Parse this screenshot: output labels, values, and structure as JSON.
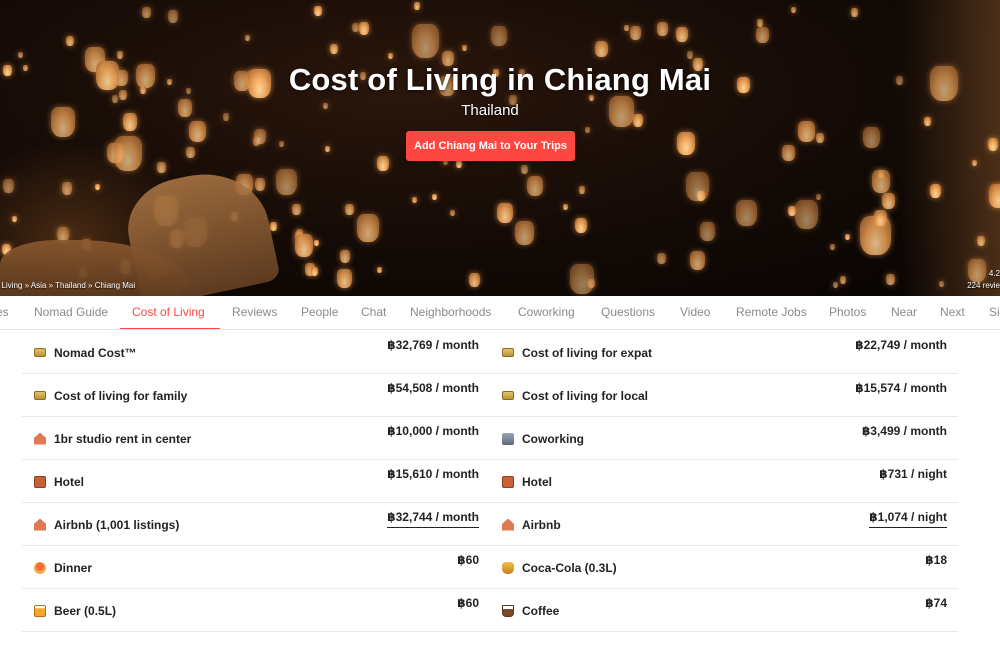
{
  "hero": {
    "title": "Cost of Living in Chiang Mai",
    "subtitle": "Thailand",
    "cta_label": "Add Chiang Mai to Your Trips",
    "breadcrumb": "f Living » Asia » Thailand » Chiang Mai",
    "rating_value": "4.2",
    "rating_reviews": "224 revie"
  },
  "tabs": [
    {
      "label": "es"
    },
    {
      "label": "Nomad Guide"
    },
    {
      "label": "Cost of Living",
      "active": true
    },
    {
      "label": "Reviews"
    },
    {
      "label": "People"
    },
    {
      "label": "Chat"
    },
    {
      "label": "Neighborhoods"
    },
    {
      "label": "Coworking"
    },
    {
      "label": "Questions"
    },
    {
      "label": "Video"
    },
    {
      "label": "Remote Jobs"
    },
    {
      "label": "Photos"
    },
    {
      "label": "Near"
    },
    {
      "label": "Next"
    },
    {
      "label": "Si"
    }
  ],
  "rows": [
    {
      "left": {
        "label": "Nomad Cost™",
        "value": "฿32,769 / month",
        "icon": "money-icon"
      },
      "right": {
        "label": "Cost of living for expat",
        "value": "฿22,749 / month",
        "icon": "money-icon"
      }
    },
    {
      "left": {
        "label": "Cost of living for family",
        "value": "฿54,508 / month",
        "icon": "money-icon"
      },
      "right": {
        "label": "Cost of living for local",
        "value": "฿15,574 / month",
        "icon": "money-icon"
      }
    },
    {
      "left": {
        "label": "1br studio rent in center",
        "value": "฿10,000 / month",
        "icon": "house-icon"
      },
      "right": {
        "label": "Coworking",
        "value": "฿3,499 / month",
        "icon": "office-icon"
      }
    },
    {
      "left": {
        "label": "Hotel",
        "value": "฿15,610 / month",
        "icon": "hotel-icon"
      },
      "right": {
        "label": "Hotel",
        "value": "฿731 / night",
        "icon": "hotel-icon"
      }
    },
    {
      "left": {
        "label": "Airbnb (1,001 listings)",
        "value": "฿32,744 / month",
        "icon": "house-icon",
        "link": true
      },
      "right": {
        "label": "Airbnb",
        "value": "฿1,074 / night",
        "icon": "house-icon",
        "link": true
      }
    },
    {
      "left": {
        "label": "Dinner",
        "value": "฿60",
        "icon": "dinner-icon"
      },
      "right": {
        "label": "Coca-Cola (0.3L)",
        "value": "฿18",
        "icon": "soda-icon"
      }
    },
    {
      "left": {
        "label": "Beer (0.5L)",
        "value": "฿60",
        "icon": "beer-icon"
      },
      "right": {
        "label": "Coffee",
        "value": "฿74",
        "icon": "coffee-icon"
      }
    }
  ]
}
